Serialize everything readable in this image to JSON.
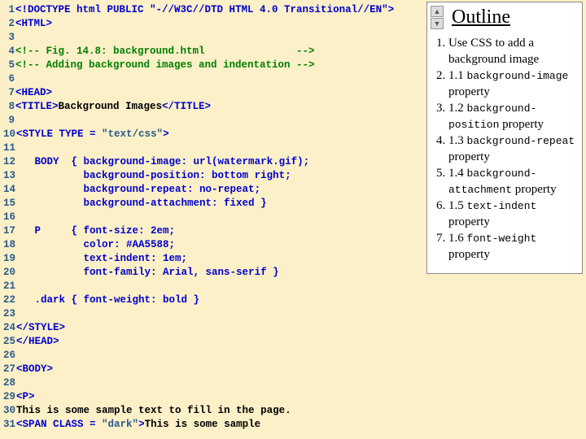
{
  "code": [
    {
      "n": "1",
      "segs": [
        {
          "c": "tag",
          "t": "<!DOCTYPE html PUBLIC \"-//W3C//DTD HTML 4.0 Transitional//EN\">"
        }
      ]
    },
    {
      "n": "2",
      "segs": [
        {
          "c": "tag",
          "t": "<HTML>"
        }
      ]
    },
    {
      "n": "3",
      "segs": []
    },
    {
      "n": "4",
      "segs": [
        {
          "c": "cmt",
          "t": "<!-- Fig. 14.8: background.html               -->"
        }
      ]
    },
    {
      "n": "5",
      "segs": [
        {
          "c": "cmt",
          "t": "<!-- Adding background images and indentation -->"
        }
      ]
    },
    {
      "n": "6",
      "segs": []
    },
    {
      "n": "7",
      "segs": [
        {
          "c": "tag",
          "t": "<HEAD>"
        }
      ]
    },
    {
      "n": "8",
      "segs": [
        {
          "c": "tag",
          "t": "<TITLE>"
        },
        {
          "c": "txt",
          "t": "Background Images"
        },
        {
          "c": "tag",
          "t": "</TITLE>"
        }
      ]
    },
    {
      "n": "9",
      "segs": []
    },
    {
      "n": "10",
      "segs": [
        {
          "c": "tag",
          "t": "<STYLE TYPE = "
        },
        {
          "c": "str",
          "t": "\"text/css\""
        },
        {
          "c": "tag",
          "t": ">"
        }
      ]
    },
    {
      "n": "11",
      "segs": []
    },
    {
      "n": "12",
      "segs": [
        {
          "c": "tag",
          "t": "   BODY  { background-image: url(watermark.gif);"
        }
      ]
    },
    {
      "n": "13",
      "segs": [
        {
          "c": "tag",
          "t": "           background-position: bottom right;"
        }
      ]
    },
    {
      "n": "14",
      "segs": [
        {
          "c": "tag",
          "t": "           background-repeat: no-repeat;"
        }
      ]
    },
    {
      "n": "15",
      "segs": [
        {
          "c": "tag",
          "t": "           background-attachment: fixed }"
        }
      ]
    },
    {
      "n": "16",
      "segs": []
    },
    {
      "n": "17",
      "segs": [
        {
          "c": "tag",
          "t": "   P     { font-size: 2em; "
        }
      ]
    },
    {
      "n": "18",
      "segs": [
        {
          "c": "tag",
          "t": "           color: #AA5588;"
        }
      ]
    },
    {
      "n": "19",
      "segs": [
        {
          "c": "tag",
          "t": "           text-indent: 1em;"
        }
      ]
    },
    {
      "n": "20",
      "segs": [
        {
          "c": "tag",
          "t": "           font-family: Arial, sans-serif }"
        }
      ]
    },
    {
      "n": "21",
      "segs": []
    },
    {
      "n": "22",
      "segs": [
        {
          "c": "tag",
          "t": "   .dark { font-weight: bold }"
        }
      ]
    },
    {
      "n": "23",
      "segs": []
    },
    {
      "n": "24",
      "segs": [
        {
          "c": "tag",
          "t": "</STYLE>"
        }
      ]
    },
    {
      "n": "25",
      "segs": [
        {
          "c": "tag",
          "t": "</HEAD>"
        }
      ]
    },
    {
      "n": "26",
      "segs": []
    },
    {
      "n": "27",
      "segs": [
        {
          "c": "tag",
          "t": "<BODY>"
        }
      ]
    },
    {
      "n": "28",
      "segs": []
    },
    {
      "n": "29",
      "segs": [
        {
          "c": "tag",
          "t": "<P>"
        }
      ]
    },
    {
      "n": "30",
      "segs": [
        {
          "c": "txt",
          "t": "This is some sample text to fill in the page."
        }
      ]
    },
    {
      "n": "31",
      "segs": [
        {
          "c": "tag",
          "t": "<SPAN CLASS = "
        },
        {
          "c": "str",
          "t": "\"dark\""
        },
        {
          "c": "tag",
          "t": ">"
        },
        {
          "c": "txt",
          "t": "This is some sample"
        }
      ]
    }
  ],
  "outline": {
    "title": "Outline",
    "items": [
      [
        {
          "c": "serif",
          "t": "Use CSS to add a background image"
        }
      ],
      [
        {
          "c": "serif",
          "t": "1.1  "
        },
        {
          "c": "mono",
          "t": "background-image"
        },
        {
          "c": "serif",
          "t": " property"
        }
      ],
      [
        {
          "c": "serif",
          "t": "1.2  "
        },
        {
          "c": "mono",
          "t": "background-position"
        },
        {
          "c": "serif",
          "t": " property"
        }
      ],
      [
        {
          "c": "serif",
          "t": "1.3  "
        },
        {
          "c": "mono",
          "t": "background-repeat"
        },
        {
          "c": "serif",
          "t": " property"
        }
      ],
      [
        {
          "c": "serif",
          "t": "1.4  "
        },
        {
          "c": "mono",
          "t": "background-attachment"
        },
        {
          "c": "serif",
          "t": " property"
        }
      ],
      [
        {
          "c": "serif",
          "t": "1.5  "
        },
        {
          "c": "mono",
          "t": "text-indent"
        },
        {
          "c": "serif",
          "t": " property"
        }
      ],
      [
        {
          "c": "serif",
          "t": "1.6  "
        },
        {
          "c": "mono",
          "t": "font-weight"
        },
        {
          "c": "serif",
          "t": " property"
        }
      ]
    ]
  }
}
